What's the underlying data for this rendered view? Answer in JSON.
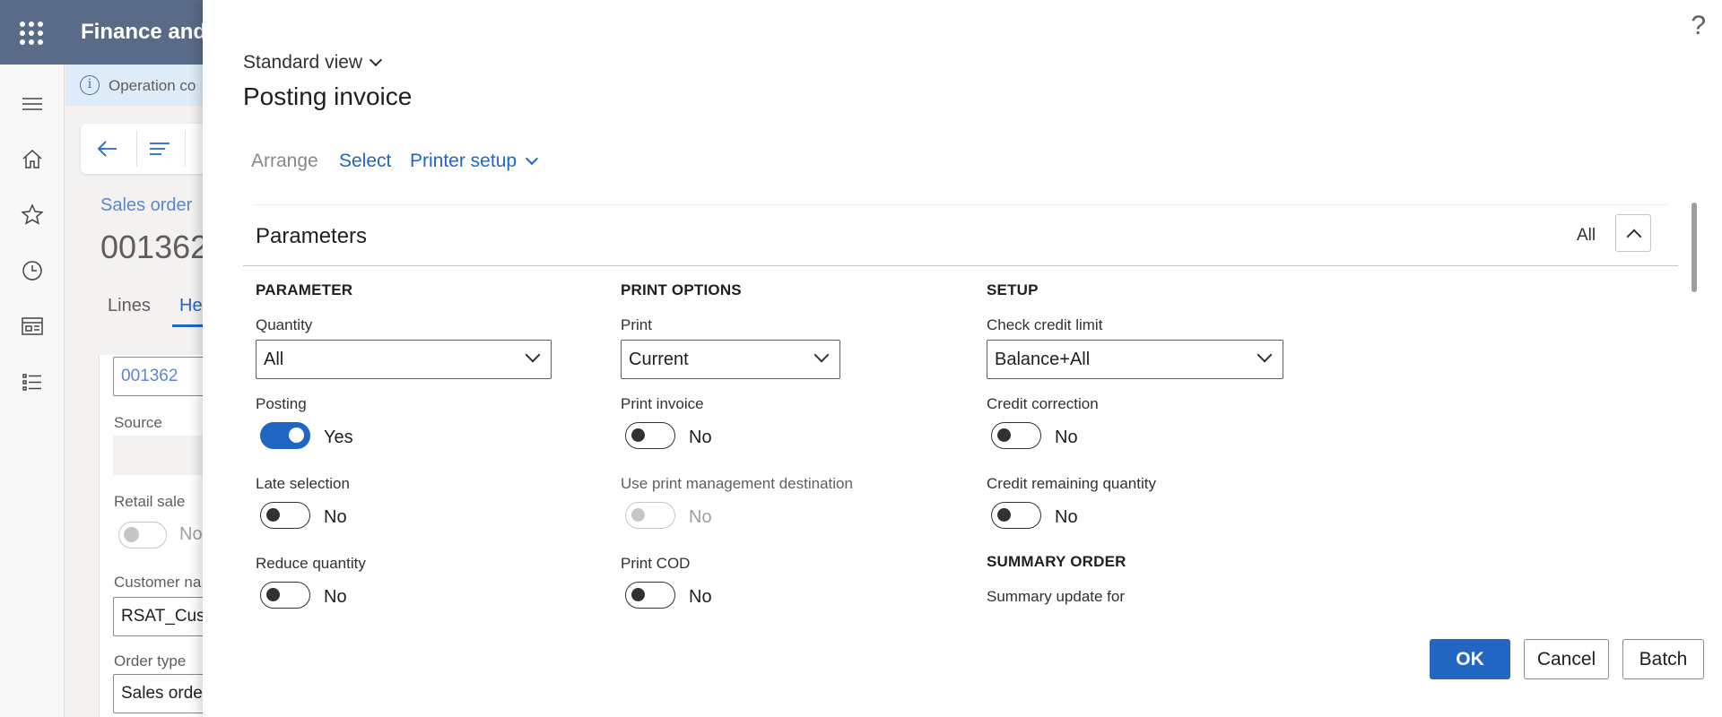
{
  "app": {
    "title": "Finance and"
  },
  "info_bar": {
    "text": "Operation co"
  },
  "background": {
    "breadcrumb": "Sales order",
    "order_number": "001362",
    "tabs": [
      "Lines",
      "He"
    ],
    "order_field_value": "001362",
    "source_label": "Source",
    "retail_sale_label": "Retail sale",
    "retail_sale_value": "No",
    "customer_name_label": "Customer na",
    "customer_name_value": "RSAT_Cus",
    "order_type_label": "Order type",
    "order_type_value": "Sales orde"
  },
  "dialog": {
    "view": "Standard view",
    "title": "Posting invoice",
    "help": "?",
    "commands": {
      "arrange": "Arrange",
      "select": "Select",
      "printer_setup": "Printer setup"
    },
    "section": {
      "title": "Parameters",
      "filter": "All"
    },
    "parameter": {
      "heading": "PARAMETER",
      "quantity_label": "Quantity",
      "quantity_value": "All",
      "posting_label": "Posting",
      "posting_value": "Yes",
      "late_selection_label": "Late selection",
      "late_selection_value": "No",
      "reduce_quantity_label": "Reduce quantity",
      "reduce_quantity_value": "No"
    },
    "print_options": {
      "heading": "PRINT OPTIONS",
      "print_label": "Print",
      "print_value": "Current",
      "print_invoice_label": "Print invoice",
      "print_invoice_value": "No",
      "use_pm_dest_label": "Use print management destination",
      "use_pm_dest_value": "No",
      "print_cod_label": "Print COD",
      "print_cod_value": "No"
    },
    "setup": {
      "heading": "SETUP",
      "check_credit_label": "Check credit limit",
      "check_credit_value": "Balance+All",
      "credit_correction_label": "Credit correction",
      "credit_correction_value": "No",
      "credit_remaining_label": "Credit remaining quantity",
      "credit_remaining_value": "No"
    },
    "summary": {
      "heading": "SUMMARY ORDER",
      "update_for_label": "Summary update for"
    },
    "buttons": {
      "ok": "OK",
      "cancel": "Cancel",
      "batch": "Batch"
    }
  }
}
